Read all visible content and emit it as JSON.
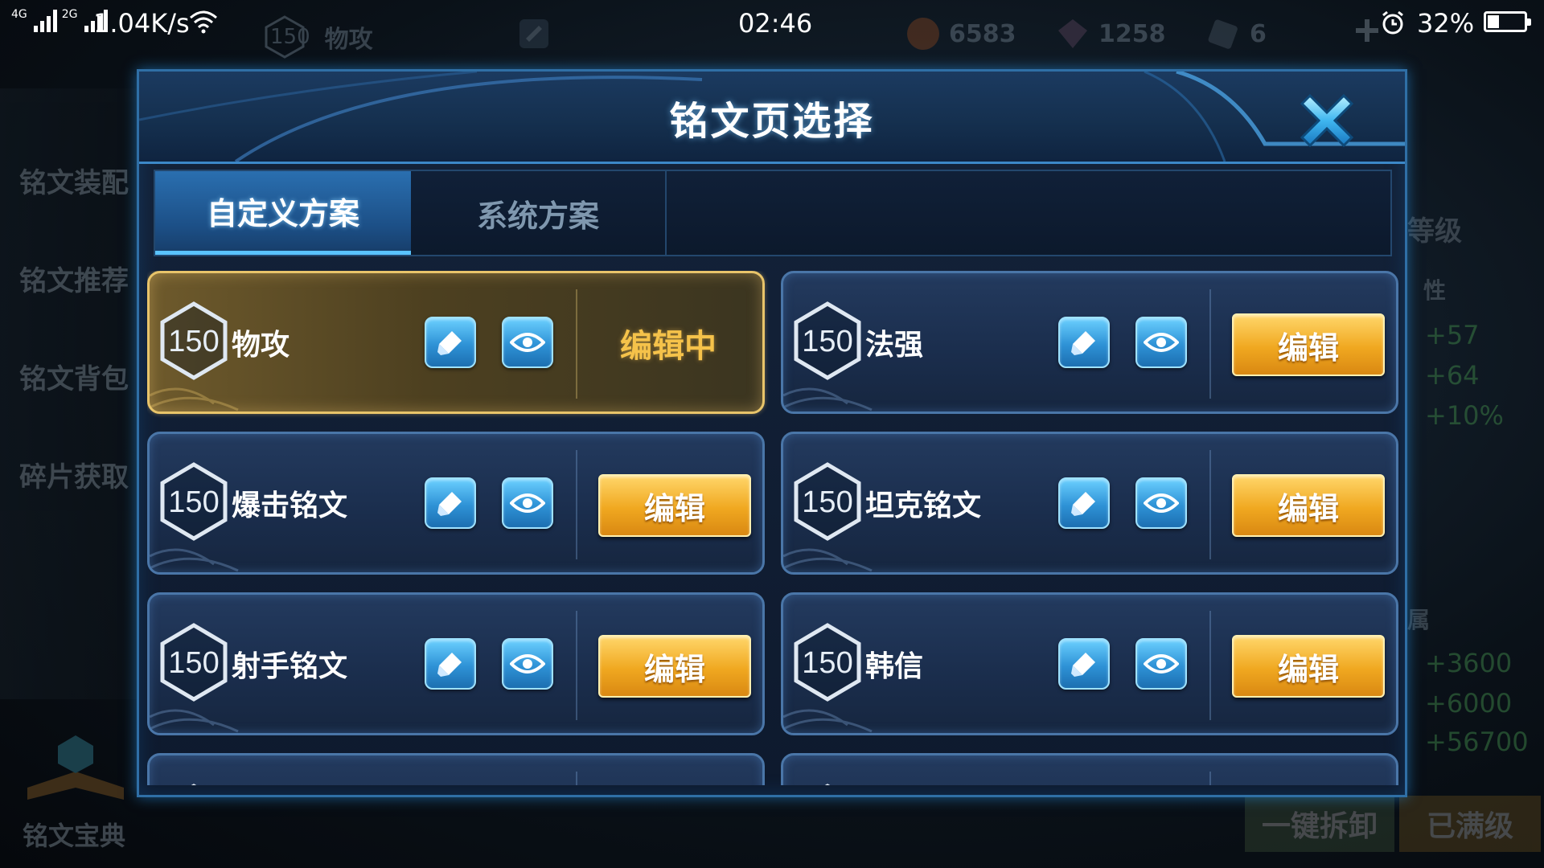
{
  "status_bar": {
    "network_1": "4G",
    "network_2": "2G",
    "speed": "1.04K/s",
    "time": "02:46",
    "battery_percent": "32%",
    "battery_level": 0.32
  },
  "background": {
    "top_level": "150",
    "top_name": "物攻",
    "coins": "6583",
    "gems": "1258",
    "tickets": "6",
    "sidebar": [
      "铭文装配",
      "铭文推荐",
      "铭文背包",
      "碎片获取"
    ],
    "book_label": "铭文宝典",
    "right_label_level": "等级",
    "right_label_attr": "性",
    "right_stats_1": [
      "+57",
      "+64",
      "+10%"
    ],
    "right_label_attr2": "属",
    "right_stats_2": [
      "+3600",
      "+6000",
      "+56700"
    ],
    "btn_unload": "一键拆卸",
    "btn_maxed": "已满级"
  },
  "modal": {
    "title": "铭文页选择",
    "tabs": [
      {
        "label": "自定义方案",
        "active": true
      },
      {
        "label": "系统方案",
        "active": false
      }
    ],
    "cards": [
      {
        "level": "150",
        "name": "物攻",
        "state": "编辑中",
        "active": true
      },
      {
        "level": "150",
        "name": "法强",
        "action": "编辑",
        "active": false
      },
      {
        "level": "150",
        "name": "爆击铭文",
        "action": "编辑",
        "active": false
      },
      {
        "level": "150",
        "name": "坦克铭文",
        "action": "编辑",
        "active": false
      },
      {
        "level": "150",
        "name": "射手铭文",
        "action": "编辑",
        "active": false
      },
      {
        "level": "150",
        "name": "韩信",
        "action": "编辑",
        "active": false
      }
    ]
  },
  "colors": {
    "accent_blue": "#59c3ff",
    "gold": "#f0a820",
    "active_border": "#e8c46a"
  },
  "icons": [
    "close-icon",
    "rename-icon",
    "eye-icon",
    "hexagon-level-icon",
    "wifi-icon",
    "alarm-icon",
    "battery-icon"
  ]
}
